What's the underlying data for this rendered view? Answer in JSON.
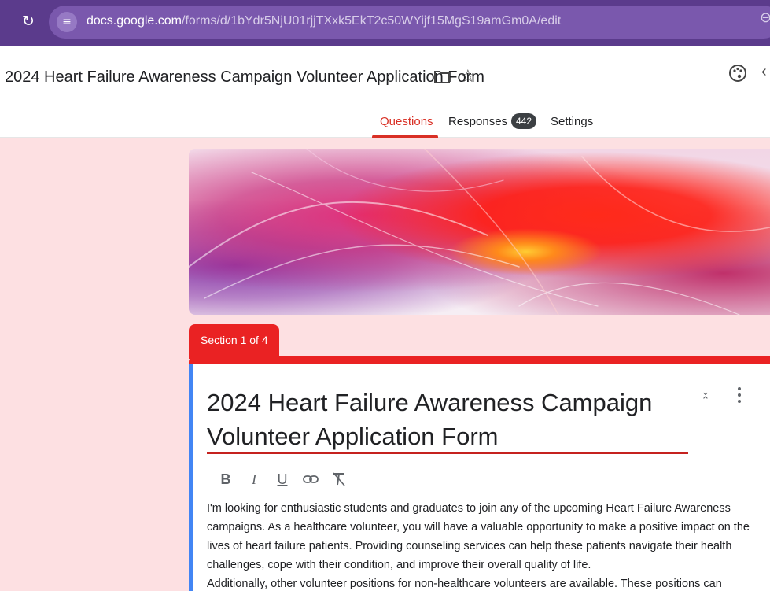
{
  "browser": {
    "url_host": "docs.google.com",
    "url_path": "/forms/d/1bYdr5NjU01rjjTXxk5EkT2c50WYijf15MgS19amGm0A/edit"
  },
  "header": {
    "doc_title": "2024 Heart Failure Awareness Campaign Volunteer Application Form",
    "tabs": [
      {
        "label": "Questions",
        "active": true
      },
      {
        "label": "Responses",
        "badge": "442"
      },
      {
        "label": "Settings"
      }
    ]
  },
  "section": {
    "label": "Section 1 of 4"
  },
  "form": {
    "title": "2024 Heart Failure Awareness Campaign Volunteer Application Form",
    "toolbar": {
      "bold": "B",
      "italic": "I",
      "underline": "U"
    },
    "description": [
      "I'm looking for enthusiastic students and graduates to join any of the upcoming Heart Failure Awareness campaigns. As a healthcare volunteer, you will have a valuable opportunity to make a positive impact on the lives of heart failure patients. Providing counseling services can help these patients navigate their health challenges, cope with their condition, and improve their overall quality of life.",
      "Additionally, other volunteer positions for non-healthcare volunteers are available. These positions can"
    ]
  },
  "colors": {
    "browser_bar": "#5b3b8c",
    "accent_red": "#ea2223",
    "card_left_bar": "#4285f4",
    "page_bg": "#fde0e2"
  },
  "icons": [
    "reload-icon",
    "site-settings-icon",
    "zoom-icon",
    "folder-icon",
    "star-icon",
    "palette-icon",
    "collapse-icon",
    "more-vert-icon",
    "link-icon",
    "clear-format-icon"
  ]
}
